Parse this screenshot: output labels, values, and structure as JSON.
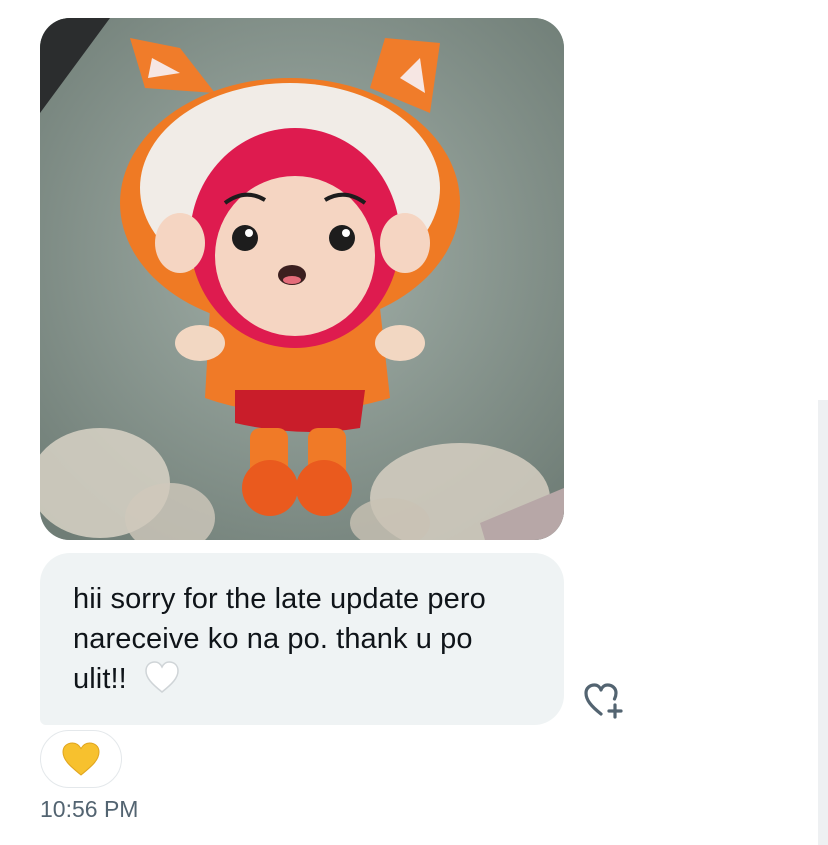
{
  "message": {
    "image": {
      "alt_icon": "plush-doll-photo"
    },
    "text": "hii sorry for the late update pero nareceive ko na po. thank u po ulit!!",
    "inline_emoji": "white-heart-icon",
    "reaction_emoji": "yellow-heart-icon",
    "timestamp": "10:56 PM"
  },
  "actions": {
    "add_reaction_icon": "heart-plus-icon"
  },
  "colors": {
    "bubble_bg": "#eff3f4",
    "text": "#0f1419",
    "meta_text": "#536471",
    "reaction_heart": "#f7c12e"
  }
}
